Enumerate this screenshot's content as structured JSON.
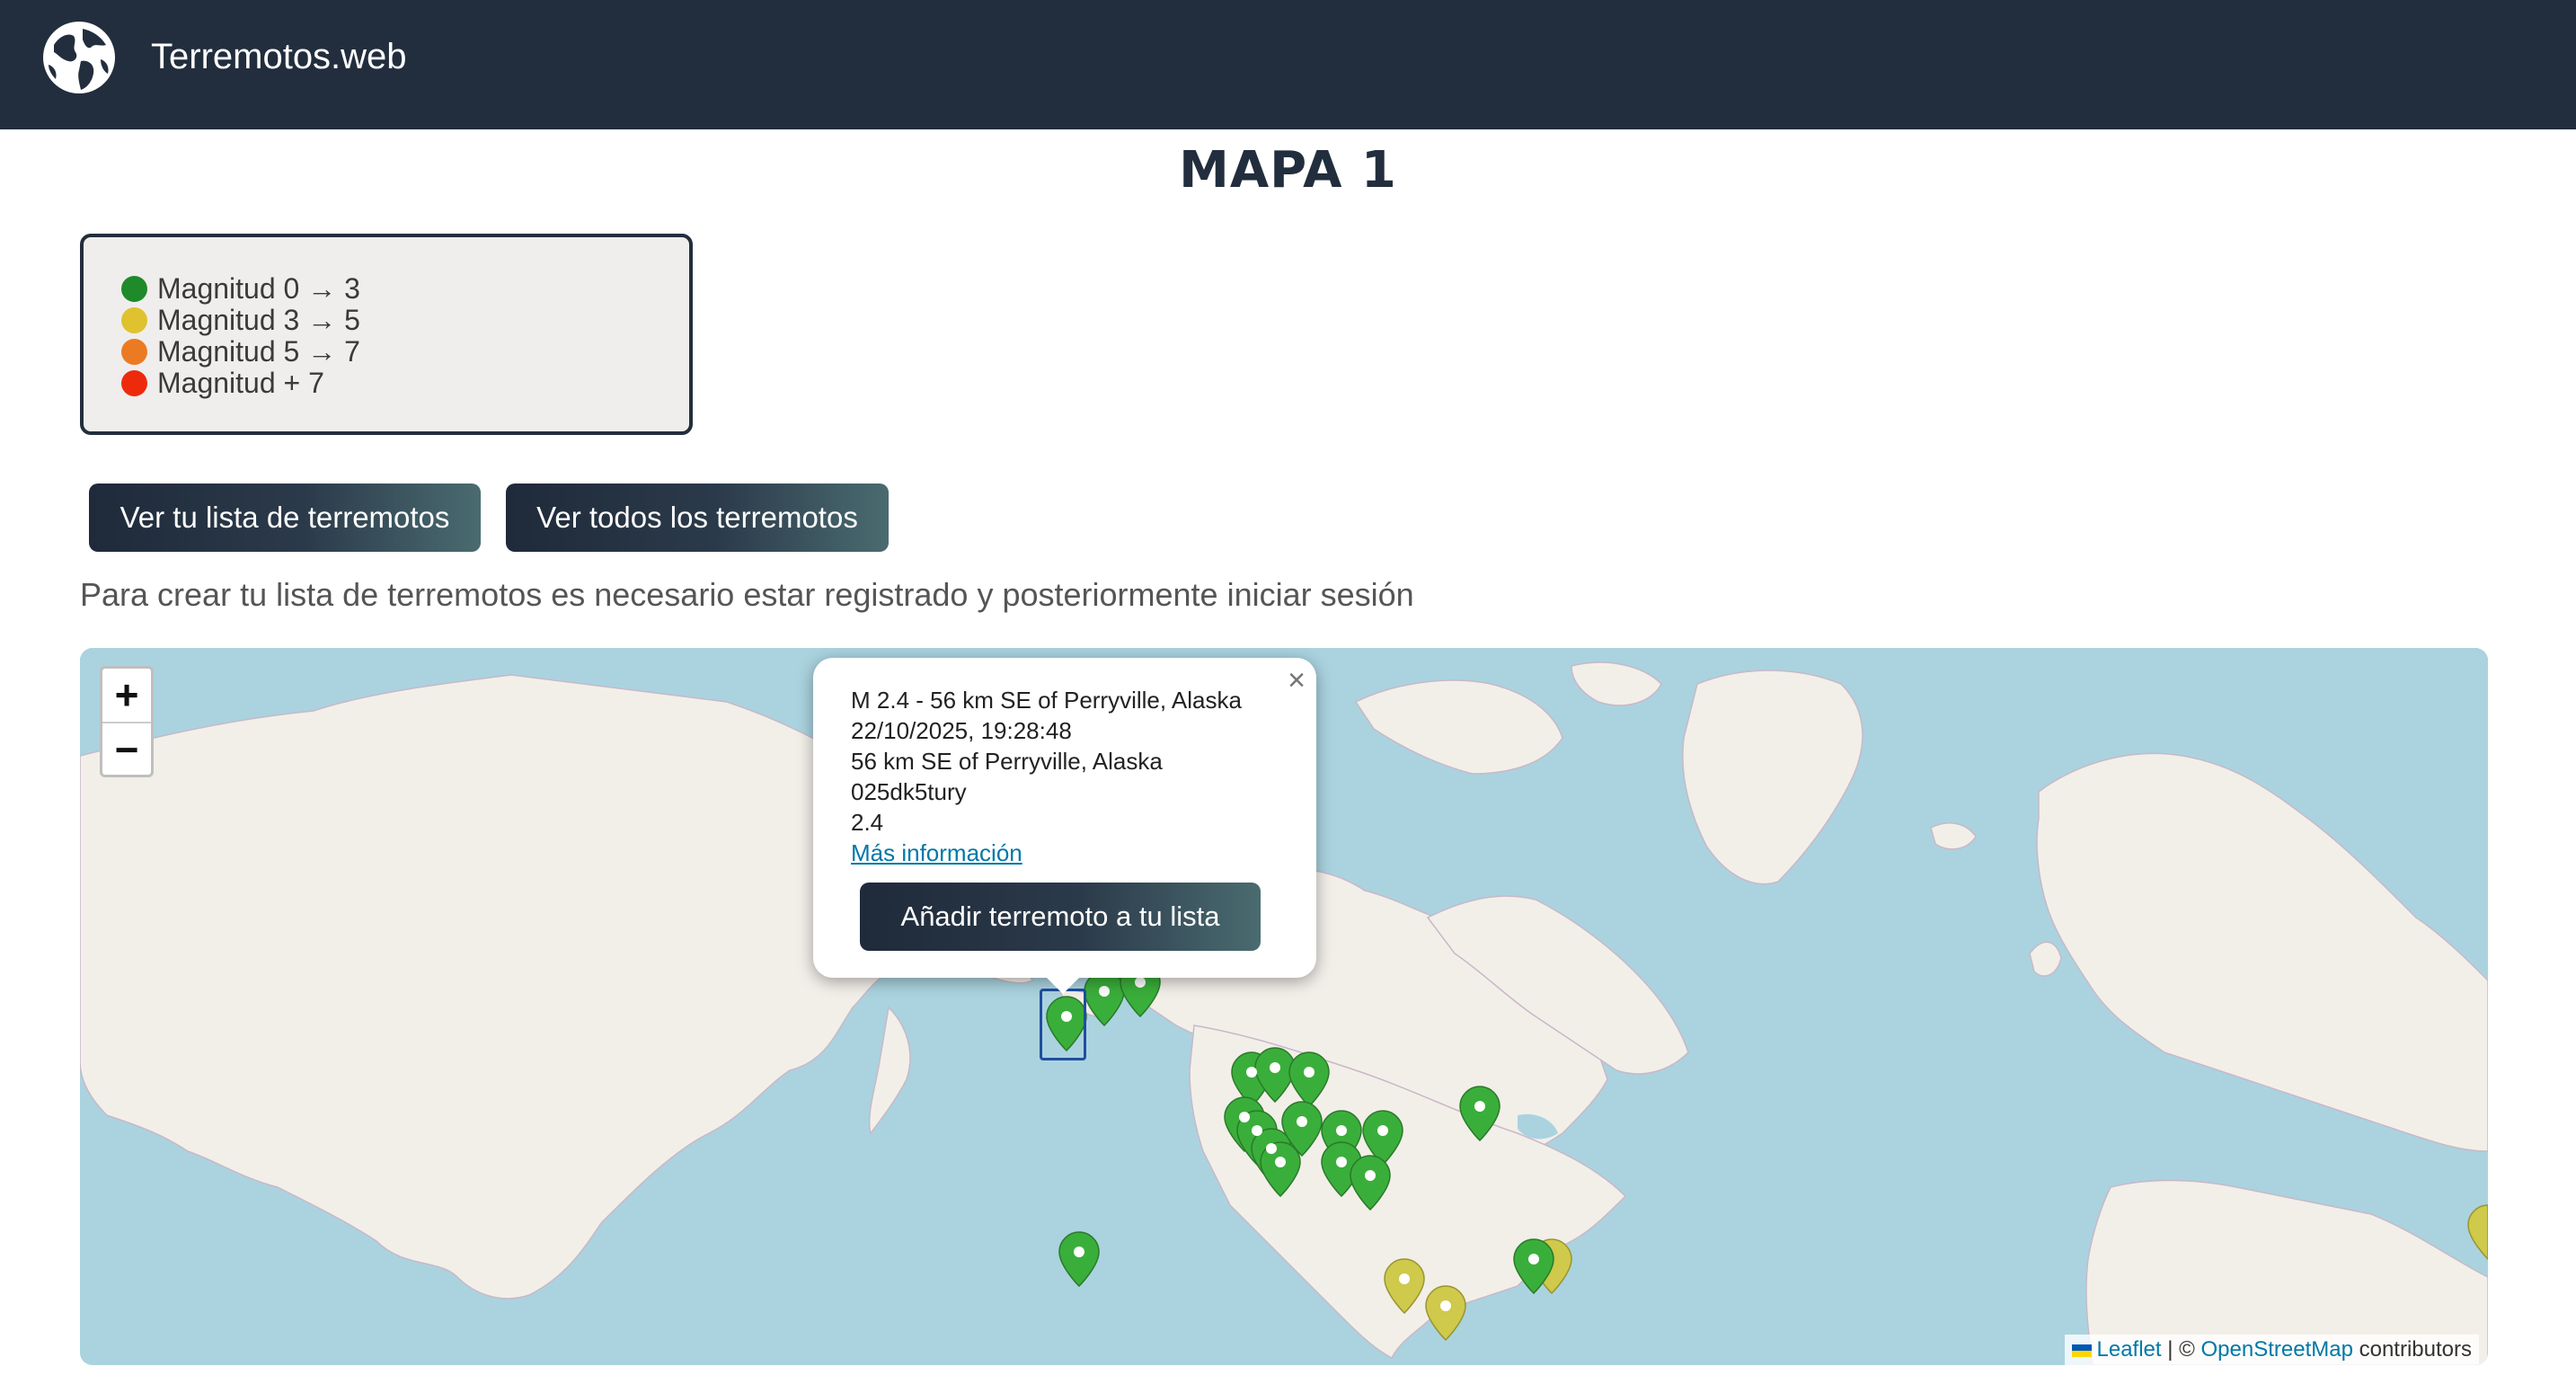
{
  "nav": {
    "brand": "Terremotos.web",
    "logo_icon": "globe-icon"
  },
  "page": {
    "title": "MAPA 1"
  },
  "legend": {
    "items": [
      {
        "label": "Magnitud 0 → 3",
        "color": "#1e8a2a"
      },
      {
        "label": "Magnitud 3 → 5",
        "color": "#e0c12e"
      },
      {
        "label": "Magnitud 5 → 7",
        "color": "#ec7a23"
      },
      {
        "label": "Magnitud + 7",
        "color": "#ee2a0d"
      }
    ]
  },
  "buttons": {
    "my_list": "Ver tu lista de terremotos",
    "all": "Ver todos los terremotos"
  },
  "notice": "Para crear tu lista de terremotos es necesario estar registrado y posteriormente iniciar sesión",
  "map": {
    "zoom_in": "+",
    "zoom_out": "−",
    "attribution": {
      "leaflet": "Leaflet",
      "separator": " | © ",
      "osm": "OpenStreetMap",
      "suffix": " contributors"
    },
    "marker_colors": {
      "green": "#3aae3a",
      "yellow": "#cfc94c"
    },
    "popup": {
      "title": "M 2.4 - 56 km SE of Perryville, Alaska",
      "datetime": "22/10/2025, 19:28:48",
      "place": "56 km SE of Perryville, Alaska",
      "code": "025dk5tury",
      "magnitude": "2.4",
      "link": "Más información",
      "add_button": "Añadir terremoto a tu lista",
      "close": "×"
    }
  }
}
